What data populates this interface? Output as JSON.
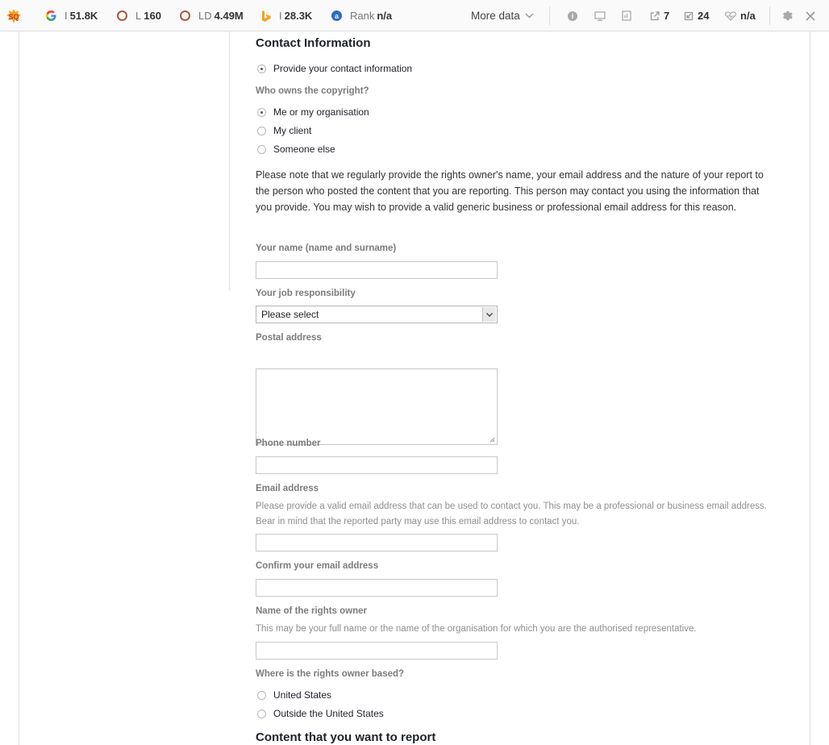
{
  "toolbar": {
    "google_prefix": "I",
    "google_index": "51.8K",
    "links_prefix": "L",
    "links": "160",
    "link_domains_prefix": "LD",
    "link_domains": "4.49M",
    "bing_prefix": "I",
    "bing_index": "28.3K",
    "rank_label": "Rank",
    "rank_value": "n/a",
    "more_data": "More data",
    "external_links": "7",
    "internal_links": "24",
    "health": "n/a",
    "colors": {
      "accent_orange": "#f7a21b",
      "google_blue": "#4285f4",
      "circle_red": "#b5553a"
    }
  },
  "form": {
    "contact_heading": "Contact Information",
    "provide_contact": "Provide your contact information",
    "copyright_question": "Who owns the copyright?",
    "copyright_options": [
      "Me or my organisation",
      "My client",
      "Someone else"
    ],
    "copyright_selected": "Me or my organisation",
    "notice": "Please note that we regularly provide the rights owner's name, your email address and the nature of your report to the person who posted the content that you are reporting. This person may contact you using the information that you provide. You may wish to provide a valid generic business or professional email address for this reason.",
    "name_label": "Your name (name and surname)",
    "name_value": "",
    "job_label": "Your job responsibility",
    "job_selected": "Please select",
    "postal_label": "Postal address",
    "postal_value": "",
    "phone_label": "Phone number",
    "phone_value": "",
    "email_label": "Email address",
    "email_help": "Please provide a valid email address that can be used to contact you. This may be a professional or business email address. Bear in mind that the reported party may use this email address to contact you.",
    "email_value": "",
    "confirm_email_label": "Confirm your email address",
    "confirm_email_value": "",
    "rights_owner_label": "Name of the rights owner",
    "rights_owner_help": "This may be your full name or the name of the organisation for which you are the authorised representative.",
    "rights_owner_value": "",
    "based_question": "Where is the rights owner based?",
    "based_options": [
      "United States",
      "Outside the United States"
    ],
    "content_heading": "Content that you want to report"
  }
}
